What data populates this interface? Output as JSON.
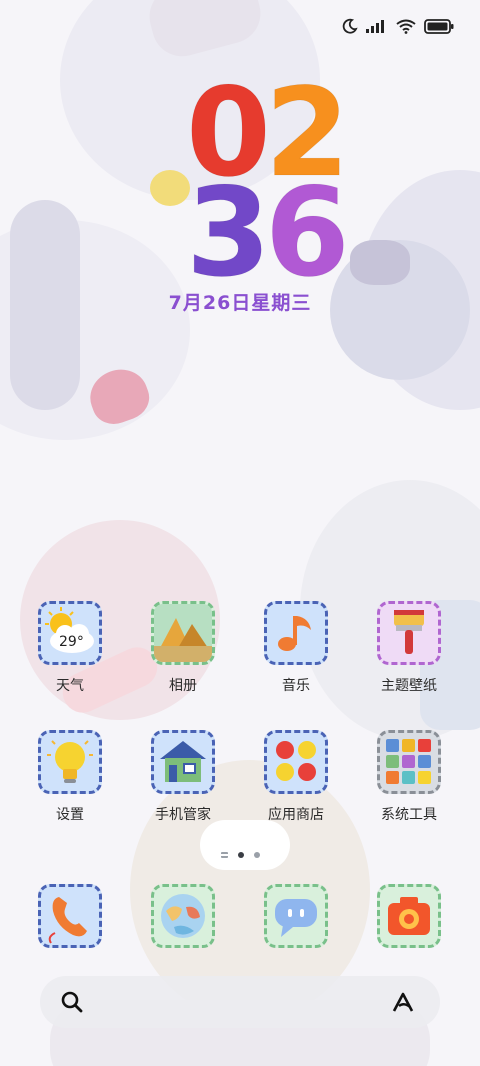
{
  "clock": {
    "hours": [
      "0",
      "2"
    ],
    "minutes": [
      "3",
      "6"
    ]
  },
  "date": "7月26日星期三",
  "apps": [
    {
      "label": "天气",
      "icon": "weather-icon",
      "temp": "29°"
    },
    {
      "label": "相册",
      "icon": "gallery-icon"
    },
    {
      "label": "音乐",
      "icon": "music-icon"
    },
    {
      "label": "主题壁纸",
      "icon": "theme-brush-icon"
    },
    {
      "label": "设置",
      "icon": "lightbulb-settings-icon"
    },
    {
      "label": "手机管家",
      "icon": "house-icon"
    },
    {
      "label": "应用商店",
      "icon": "app-store-balls-icon"
    },
    {
      "label": "系统工具",
      "icon": "tools-grid-icon"
    }
  ],
  "dock": [
    {
      "icon": "phone-icon"
    },
    {
      "icon": "browser-icon"
    },
    {
      "icon": "messages-icon"
    },
    {
      "icon": "camera-icon"
    }
  ],
  "status_bar": {
    "icons": [
      "moon-icon",
      "signal-icon",
      "wifi-icon",
      "battery-icon"
    ]
  },
  "search_bar": {
    "icons": [
      "search-icon",
      "assistant-icon"
    ]
  },
  "colors": {
    "accent_purple": "#8a4fd0",
    "digit_red": "#e63b2e",
    "digit_orange": "#f7901e",
    "digit_purple": "#7248c8",
    "digit_violet": "#b159d4"
  }
}
